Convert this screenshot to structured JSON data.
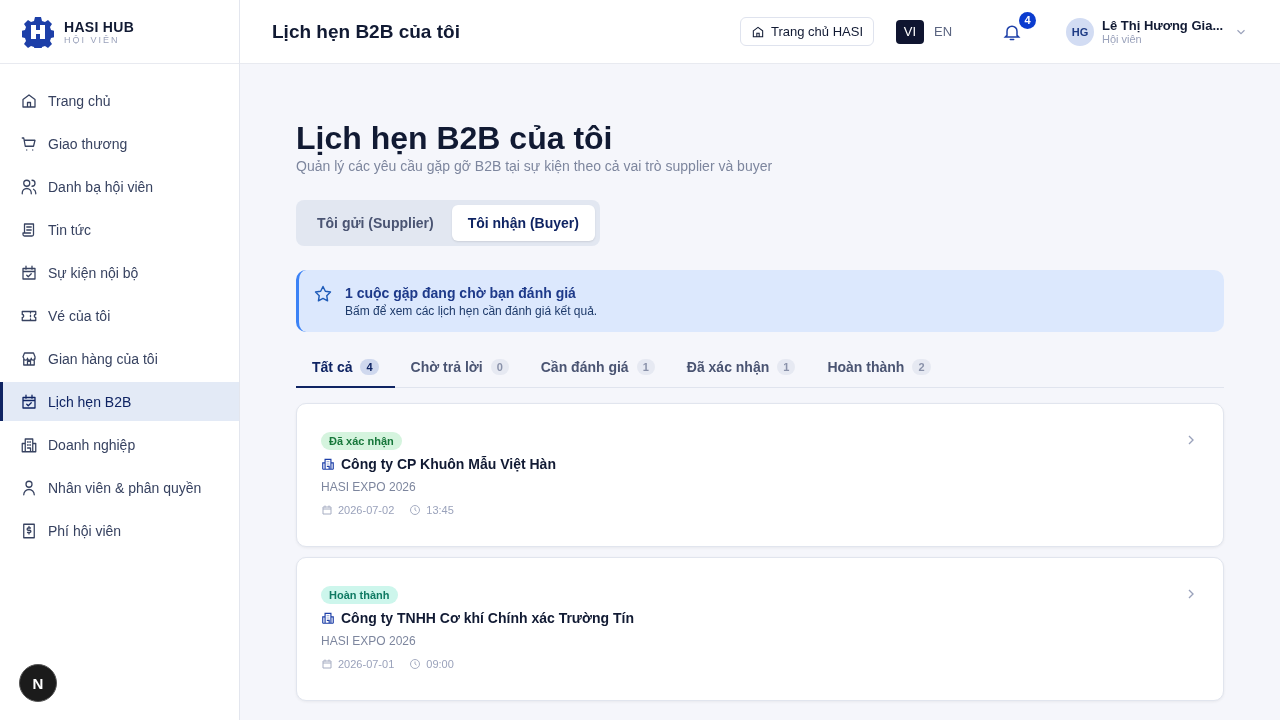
{
  "brand": {
    "name": "HASI HUB",
    "subtitle": "HỘI VIÊN"
  },
  "sidebar": {
    "items": [
      {
        "label": "Trang chủ",
        "selected": false
      },
      {
        "label": "Giao thương",
        "selected": false
      },
      {
        "label": "Danh bạ hội viên",
        "selected": false
      },
      {
        "label": "Tin tức",
        "selected": false
      },
      {
        "label": "Sự kiện nội bộ",
        "selected": false
      },
      {
        "label": "Vé của tôi",
        "selected": false
      },
      {
        "label": "Gian hàng của tôi",
        "selected": false
      },
      {
        "label": "Lịch hẹn B2B",
        "selected": true
      },
      {
        "label": "Doanh nghiệp",
        "selected": false
      },
      {
        "label": "Nhân viên & phân quyền",
        "selected": false
      },
      {
        "label": "Phí hội viên",
        "selected": false
      }
    ]
  },
  "dev_badge": "N",
  "header": {
    "title": "Lịch hẹn B2B của tôi",
    "home_button": "Trang chủ HASI",
    "languages": [
      {
        "label": "VI",
        "selected": true
      },
      {
        "label": "EN",
        "selected": false
      }
    ],
    "notification_count": "4",
    "user": {
      "initials": "HG",
      "name": "Lê Thị Hương Gia...",
      "role": "Hội viên"
    }
  },
  "page": {
    "title": "Lịch hẹn B2B của tôi",
    "subtitle": "Quản lý các yêu cầu gặp gỡ B2B tại sự kiện theo cả vai trò supplier và buyer",
    "roles": [
      {
        "label": "Tôi gửi (Supplier)",
        "selected": false
      },
      {
        "label": "Tôi nhận (Buyer)",
        "selected": true
      }
    ],
    "notice": {
      "title": "1 cuộc gặp đang chờ bạn đánh giá",
      "text": "Bấm để xem các lịch hẹn cần đánh giá kết quả."
    },
    "tabs": [
      {
        "label": "Tất cả",
        "count": "4",
        "selected": true
      },
      {
        "label": "Chờ trả lời",
        "count": "0",
        "selected": false
      },
      {
        "label": "Cần đánh giá",
        "count": "1",
        "selected": false
      },
      {
        "label": "Đã xác nhận",
        "count": "1",
        "selected": false
      },
      {
        "label": "Hoàn thành",
        "count": "2",
        "selected": false
      }
    ],
    "appointments": [
      {
        "status": "Đã xác nhận",
        "kind": "confirmed",
        "company": "Công ty CP Khuôn Mẫu Việt Hàn",
        "event": "HASI EXPO 2026",
        "date": "2026-07-02",
        "time": "13:45"
      },
      {
        "status": "Hoàn thành",
        "kind": "completed",
        "company": "Công ty TNHH Cơ khí Chính xác Trường Tín",
        "event": "HASI EXPO 2026",
        "date": "2026-07-01",
        "time": "09:00"
      }
    ]
  }
}
